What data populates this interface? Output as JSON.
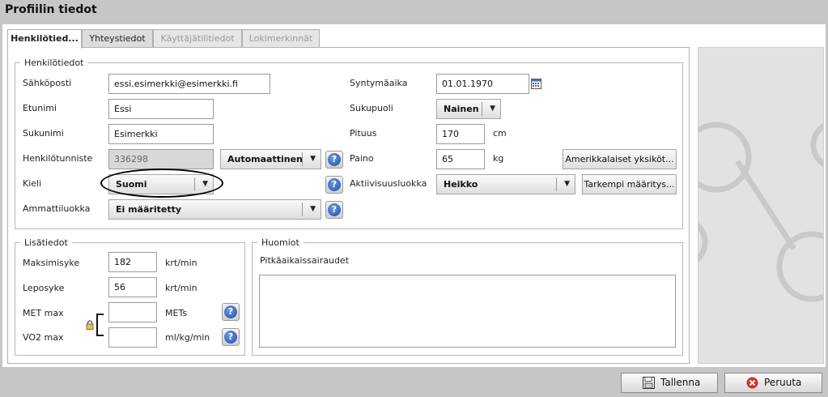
{
  "window": {
    "title": "Profiilin tiedot"
  },
  "tabs": [
    {
      "label": "Henkilötied...",
      "state": "active"
    },
    {
      "label": "Yhteystiedot",
      "state": "normal"
    },
    {
      "label": "Käyttäjätilitiedot",
      "state": "disabled"
    },
    {
      "label": "Lokimerkinnät",
      "state": "disabled"
    }
  ],
  "personal": {
    "legend": "Henkilötiedot",
    "email": {
      "label": "Sähköposti",
      "value": "essi.esimerkki@esimerkki.fi"
    },
    "firstname": {
      "label": "Etunimi",
      "value": "Essi"
    },
    "lastname": {
      "label": "Sukunimi",
      "value": "Esimerkki"
    },
    "ssn": {
      "label": "Henkilötunniste",
      "value": "336298",
      "mode": "Automaattinen"
    },
    "language": {
      "label": "Kieli",
      "value": "Suomi"
    },
    "occupation": {
      "label": "Ammattiluokka",
      "value": "Ei määritetty"
    },
    "birthdate": {
      "label": "Syntymäaika",
      "value": "01.01.1970"
    },
    "gender": {
      "label": "Sukupuoli",
      "value": "Nainen"
    },
    "height": {
      "label": "Pituus",
      "value": "170",
      "unit": "cm"
    },
    "weight": {
      "label": "Paino",
      "value": "65",
      "unit": "kg",
      "button": "Amerikkalaiset yksiköt..."
    },
    "activity": {
      "label": "Aktiivisuusluokka",
      "value": "Heikko",
      "button": "Tarkempi määritys..."
    }
  },
  "extra": {
    "legend": "Lisätiedot",
    "maxhr": {
      "label": "Maksimisyke",
      "value": "182",
      "unit": "krt/min"
    },
    "resthr": {
      "label": "Leposyke",
      "value": "56",
      "unit": "krt/min"
    },
    "metmax": {
      "label": "MET max",
      "value": "",
      "unit": "METs"
    },
    "vo2max": {
      "label": "VO2 max",
      "value": "",
      "unit": "ml/kg/min"
    }
  },
  "notes": {
    "legend": "Huomiot",
    "chronic_label": "Pitkäaikaissairaudet",
    "chronic_value": ""
  },
  "footer": {
    "save": "Tallenna",
    "cancel": "Peruuta"
  },
  "help_glyph": "?",
  "dropdown_arrow": "▼",
  "colors": {
    "background": "#c6c6c6",
    "help_blue": "#1d4fa8",
    "cancel_red": "#d9302a"
  }
}
